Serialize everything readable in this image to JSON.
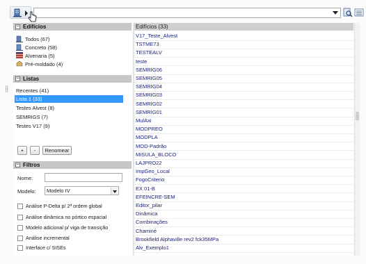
{
  "toolbar": {
    "combo_value": ""
  },
  "sections": {
    "edificios": "Edifícios",
    "listas": "Listas",
    "filtros": "Filtros"
  },
  "edificios": [
    {
      "label": "Todos (67)",
      "icon": "all-buildings-icon"
    },
    {
      "label": "Concreto (58)",
      "icon": "concrete-building-icon"
    },
    {
      "label": "Alvenaria (5)",
      "icon": "masonry-icon"
    },
    {
      "label": "Pré-moldado (4)",
      "icon": "precast-icon"
    }
  ],
  "listas": [
    "Recentes (41)",
    "Lista 1 (33)",
    "Testes Alvest (8)",
    "SEMRIGS (7)",
    "Testes V17 (9)"
  ],
  "listas_buttons": {
    "add": "+",
    "remove": "-",
    "rename": "Renomear"
  },
  "filtros": {
    "nome_label": "Nome:",
    "nome_value": "",
    "modelo_label": "Modelo:",
    "modelo_value": "Modelo IV",
    "checks": [
      "Análise P-Delta p/ 2ª ordem global",
      "Análise dinâmica no pórtico espacial",
      "Modelo adicional p/ viga de transição",
      "Análise incremental",
      "Interface c/ SISEs"
    ]
  },
  "right": {
    "header": "Edifícios (33)",
    "items": [
      "V17_Teste_Alvest",
      "TSTME73",
      "TESTEALV",
      "teste",
      "SEMRIG06",
      "SEMRIG05",
      "SEMRIG04",
      "SEMRIG03",
      "SEMRIG02",
      "SEMRIG01",
      "MulAxi",
      "MODPREO",
      "MODPLA",
      "MOD-Padrão",
      "MISULA_BLOCO",
      "LAJPRO22",
      "ImpGeo_Local",
      "FogoCriterio",
      "EX 01-B",
      "EFEINCRE-SEM",
      "Editor_pilar",
      "Dinâmica",
      "Combinações",
      "Chaminé",
      "Brookfield Alphaville rev2 fck35MPa",
      "Alv_Exemplo1"
    ]
  },
  "colors": {
    "selection": "#3399ff",
    "item_text": "#1a237e",
    "header_bg": "#c7c7c7"
  }
}
